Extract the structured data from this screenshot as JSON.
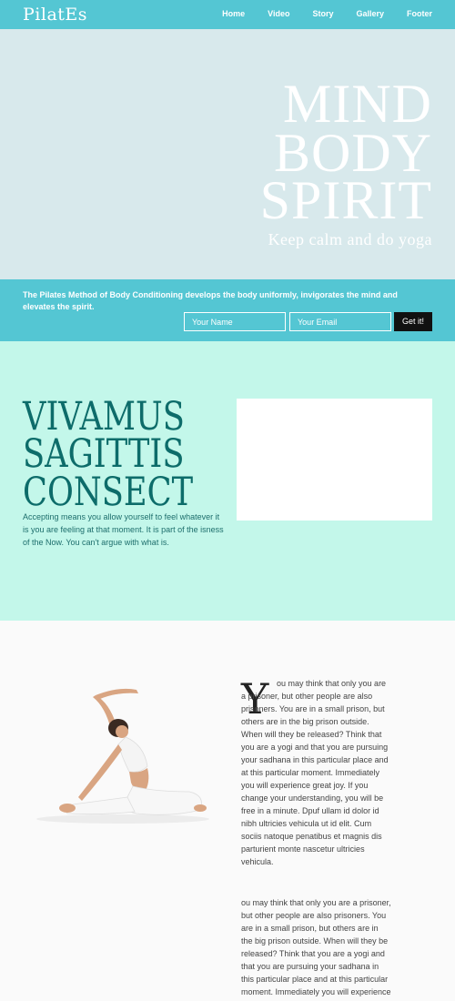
{
  "header": {
    "logo": "PilatEs",
    "nav": [
      "Home",
      "Video",
      "Story",
      "Gallery",
      "Footer"
    ]
  },
  "hero": {
    "line1": "MIND",
    "line2": "BODY",
    "line3": "SPIRIT",
    "tagline": "Keep calm and do yoga"
  },
  "signup": {
    "text": "The Pilates Method of Body Conditioning develops the body uniformly, invigorates the mind and elevates the spirit.",
    "name_placeholder": "Your Name",
    "email_placeholder": "Your Email",
    "button": "Get it!"
  },
  "feature": {
    "heading_line1": "VIVAMUS",
    "heading_line2": "SAGITTIS",
    "heading_line3": "CONSECT",
    "text": "Accepting means you allow yourself to feel whatever it is you are feeling at that moment. It is part of the isness of the Now. You can't argue with what is."
  },
  "article": {
    "dropcap": "Y",
    "para1": "ou may think that only you are a prisoner, but other people are also prisoners. You are in a small prison, but others are in the big prison outside. When will they be released? Think that you are a yogi and that you are pursuing your sadhana in this particular place and at this particular moment. Immediately you will experience great joy. If you change your understanding, you will be free in a minute. Dpuf ullam id dolor id nibh ultricies vehicula ut id elit. Cum sociis natoque penatibus et magnis dis parturient monte nascetur ultricies vehicula.",
    "para2": "ou may think that only you are a prisoner, but other people are also prisoners. You are in a small prison, but others are in the big prison outside. When will they be released? Think that you are a yogi and that you are pursuing your sadhana in this particular place and at this particular moment. Immediately you will experience great joy. If you change your"
  },
  "colors": {
    "accent": "#54c6d3",
    "mint": "#c3f7ea",
    "heading": "#0d6c6a"
  }
}
